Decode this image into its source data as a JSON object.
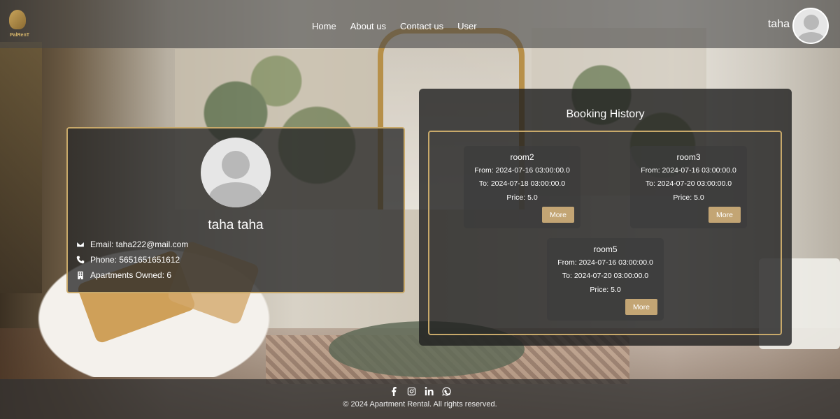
{
  "logo": {
    "text": "PalRenT"
  },
  "nav": {
    "items": [
      {
        "label": "Home"
      },
      {
        "label": "About us"
      },
      {
        "label": "Contact us"
      },
      {
        "label": "User"
      }
    ]
  },
  "header_user": {
    "name": "taha"
  },
  "profile": {
    "name": "taha taha",
    "email": "Email: taha222@mail.com",
    "phone": "Phone: 5651651651612",
    "apartments": "Apartments Owned: 6"
  },
  "booking_history": {
    "title": "Booking History",
    "bookings": [
      {
        "room": "room2",
        "from": "From: 2024-07-16 03:00:00.0",
        "to": "To: 2024-07-18 03:00:00.0",
        "price": "Price: 5.0",
        "more": "More"
      },
      {
        "room": "room3",
        "from": "From: 2024-07-16 03:00:00.0",
        "to": "To: 2024-07-20 03:00:00.0",
        "price": "Price: 5.0",
        "more": "More"
      },
      {
        "room": "room5",
        "from": "From: 2024-07-16 03:00:00.0",
        "to": "To: 2024-07-20 03:00:00.0",
        "price": "Price: 5.0",
        "more": "More"
      }
    ]
  },
  "footer": {
    "social_icons": [
      "facebook-icon",
      "instagram-icon",
      "linkedin-icon",
      "whatsapp-icon"
    ],
    "copyright": "© 2024 Apartment Rental. All rights reserved."
  },
  "colors": {
    "accent_gold": "#c8a96a",
    "button_gold": "#c3a574"
  }
}
